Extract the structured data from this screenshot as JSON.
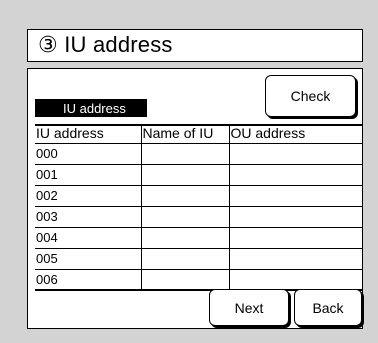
{
  "header": {
    "title": "③ IU address"
  },
  "field": {
    "label": "IU address"
  },
  "buttons": {
    "check": "Check",
    "next": "Next",
    "back": "Back"
  },
  "table": {
    "columns": [
      "IU address",
      "Name of IU",
      "OU address"
    ],
    "rows": [
      [
        "000",
        "",
        ""
      ],
      [
        "001",
        "",
        ""
      ],
      [
        "002",
        "",
        ""
      ],
      [
        "003",
        "",
        ""
      ],
      [
        "004",
        "",
        ""
      ],
      [
        "005",
        "",
        ""
      ],
      [
        "006",
        "",
        ""
      ]
    ]
  }
}
